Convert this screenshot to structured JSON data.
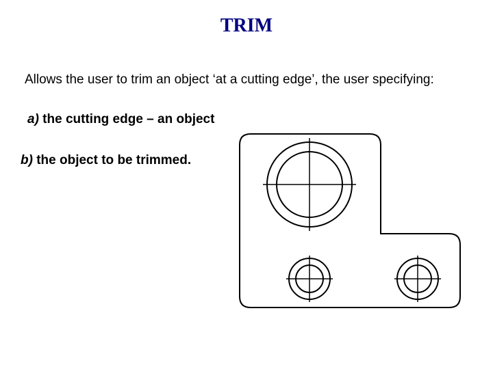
{
  "title": "TRIM",
  "intro": "Allows the user to trim an object ‘at a cutting edge’, the user specifying:",
  "point_a_prefix": "a)",
  "point_a_rest": " the cutting edge – an object",
  "point_b_prefix": "b)",
  "point_b_rest": " the object to be trimmed."
}
